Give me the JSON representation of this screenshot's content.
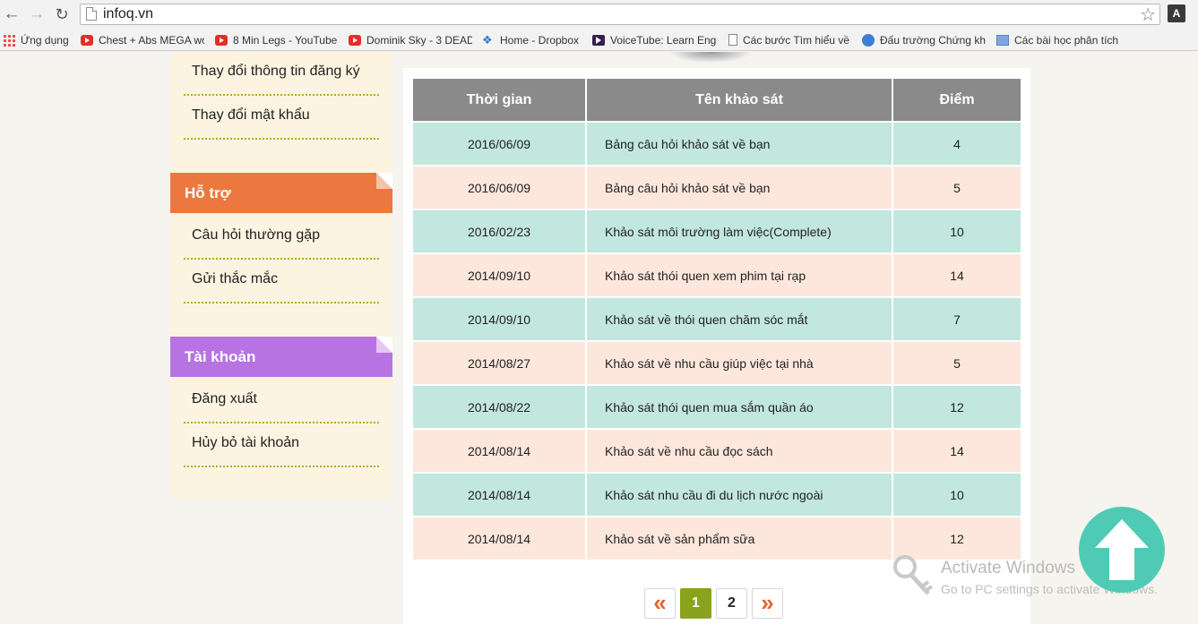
{
  "browser": {
    "url": "infoq.vn",
    "bookmarks": [
      {
        "label": "Ứng dụng",
        "icon": "apps-grid-icon"
      },
      {
        "label": "Chest + Abs MEGA wo",
        "icon": "youtube-icon"
      },
      {
        "label": "8 Min Legs - YouTube",
        "icon": "youtube-icon"
      },
      {
        "label": "Dominik Sky - 3 DEAD",
        "icon": "youtube-icon"
      },
      {
        "label": "Home - Dropbox",
        "icon": "dropbox-icon"
      },
      {
        "label": "VoiceTube: Learn Eng",
        "icon": "voicetube-icon"
      },
      {
        "label": "Các bước Tìm hiểu về",
        "icon": "document-icon"
      },
      {
        "label": "Đấu trường Chứng kh",
        "icon": "globe-icon"
      },
      {
        "label": "Các bài học phân tích",
        "icon": "chart-icon"
      }
    ]
  },
  "sidebar": {
    "profile_items": [
      "Thay đổi thông tin đăng ký",
      "Thay đổi mật khẩu"
    ],
    "support": {
      "title": "Hỗ trợ",
      "color": "#ec783f",
      "items": [
        "Câu hỏi thường gặp",
        "Gửi thắc mắc"
      ]
    },
    "account": {
      "title": "Tài khoản",
      "color": "#b773e2",
      "items": [
        "Đăng xuất",
        "Hủy bỏ tài khoản"
      ]
    }
  },
  "table": {
    "headers": [
      "Thời gian",
      "Tên khảo sát",
      "Điểm"
    ],
    "rows": [
      {
        "date": "2016/06/09",
        "name": "Bảng câu hỏi khảo sát về bạn",
        "score": "4"
      },
      {
        "date": "2016/06/09",
        "name": "Bảng câu hỏi khảo sát về bạn",
        "score": "5"
      },
      {
        "date": "2016/02/23",
        "name": "Khảo sát môi trường làm việc(Complete)",
        "score": "10"
      },
      {
        "date": "2014/09/10",
        "name": "Khảo sát thói quen xem phim tại rạp",
        "score": "14"
      },
      {
        "date": "2014/09/10",
        "name": "Khảo sát về thói quen chăm sóc mắt",
        "score": "7"
      },
      {
        "date": "2014/08/27",
        "name": "Khảo sát về nhu cầu giúp việc tại nhà",
        "score": "5"
      },
      {
        "date": "2014/08/22",
        "name": "Khảo sát thói quen mua sắm quần áo",
        "score": "12"
      },
      {
        "date": "2014/08/14",
        "name": "Khảo sát về nhu cầu đọc sách",
        "score": "14"
      },
      {
        "date": "2014/08/14",
        "name": "Khảo sát nhu cầu đi du lịch nước ngoài",
        "score": "10"
      },
      {
        "date": "2014/08/14",
        "name": "Khảo sát về sản phẩm sữa",
        "score": "12"
      }
    ],
    "row_colors": [
      "#c2e7df",
      "#fde7dc"
    ]
  },
  "pagination": {
    "prev": "«",
    "pages": [
      "1",
      "2"
    ],
    "current": "1",
    "next": "»"
  },
  "overlay": {
    "activation_title": "Activate Windows",
    "activation_subtitle": "Go to PC settings to activate Windows.",
    "scroll_top_color": "#4fcbb5"
  }
}
